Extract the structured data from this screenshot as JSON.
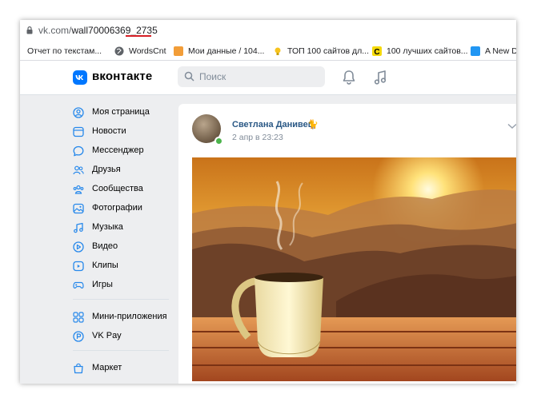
{
  "browser": {
    "url_host": "vk.com/",
    "url_path": "wall70006369_2735",
    "bookmarks": [
      {
        "label": "Отчет по текстам...",
        "icon": "docs-icon"
      },
      {
        "label": "WordsCnt",
        "icon": "globe-icon"
      },
      {
        "label": "Мои данные / 104...",
        "icon": "orange-square-icon"
      },
      {
        "label": "ТОП 100 сайтов дл...",
        "icon": "lightbulb-icon"
      },
      {
        "label": "100 лучших сайтов...",
        "icon": "c-letter-icon"
      },
      {
        "label": "A New Da",
        "icon": "blue-tile-icon"
      }
    ]
  },
  "header": {
    "brand": "вконтакте",
    "search_placeholder": "Поиск"
  },
  "sidebar": {
    "items": [
      {
        "label": "Моя страница",
        "icon": "user-circle-icon"
      },
      {
        "label": "Новости",
        "icon": "news-icon"
      },
      {
        "label": "Мессенджер",
        "icon": "message-icon"
      },
      {
        "label": "Друзья",
        "icon": "friends-icon"
      },
      {
        "label": "Сообщества",
        "icon": "communities-icon"
      },
      {
        "label": "Фотографии",
        "icon": "photo-icon"
      },
      {
        "label": "Музыка",
        "icon": "music-icon"
      },
      {
        "label": "Видео",
        "icon": "video-icon"
      },
      {
        "label": "Клипы",
        "icon": "clips-icon"
      },
      {
        "label": "Игры",
        "icon": "gamepad-icon"
      },
      {
        "label": "Мини-приложения",
        "icon": "apps-icon"
      },
      {
        "label": "VK Pay",
        "icon": "vkpay-icon"
      },
      {
        "label": "Маркет",
        "icon": "market-bag-icon"
      }
    ]
  },
  "post": {
    "author": "Светлана Данивец",
    "author_emoji": "🐈",
    "time": "2 апр в 23:23"
  },
  "colors": {
    "vk_blue": "#0077ff",
    "link": "#2a5885",
    "page_bg": "#edeef0",
    "online": "#4bb34b"
  }
}
